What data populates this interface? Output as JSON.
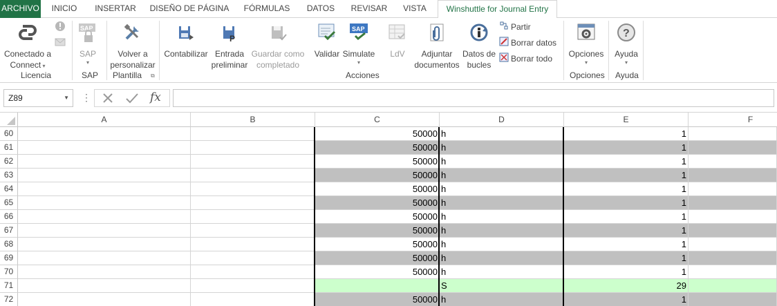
{
  "tabs": [
    "ARCHIVO",
    "INICIO",
    "INSERTAR",
    "DISEÑO DE PÁGINA",
    "FÓRMULAS",
    "DATOS",
    "REVISAR",
    "VISTA",
    "Winshuttle for Journal Entry"
  ],
  "ribbon": {
    "licencia": {
      "connect_line1": "Conectado a",
      "connect_line2": "Connect",
      "group": "Licencia"
    },
    "sap": {
      "sap_label": "SAP",
      "group": "SAP"
    },
    "plantilla": {
      "line1": "Volver a",
      "line2": "personalizar",
      "group": "Plantilla"
    },
    "acciones": {
      "contabilizar": "Contabilizar",
      "entrada_line1": "Entrada",
      "entrada_line2": "preliminar",
      "guardar_line1": "Guardar como",
      "guardar_line2": "completado",
      "validar": "Validar",
      "simulate": "Simulate",
      "ldv": "LdV",
      "adjuntar_line1": "Adjuntar",
      "adjuntar_line2": "documentos",
      "datos_line1": "Datos de",
      "datos_line2": "bucles",
      "partir": "Partir",
      "borrar_datos": "Borrar datos",
      "borrar_todo": "Borrar todo",
      "group": "Acciones"
    },
    "opciones": {
      "label": "Opciones",
      "group": "Opciones"
    },
    "ayuda": {
      "label": "Ayuda",
      "group": "Ayuda"
    }
  },
  "formula_bar": {
    "name_box": "Z89",
    "fx": "fx",
    "formula": ""
  },
  "columns": [
    "A",
    "B",
    "C",
    "D",
    "E",
    "F"
  ],
  "rows": [
    {
      "num": "60",
      "c": "50000",
      "d": "h",
      "e": "1",
      "style": "white"
    },
    {
      "num": "61",
      "c": "50000",
      "d": "h",
      "e": "1",
      "style": "gray"
    },
    {
      "num": "62",
      "c": "50000",
      "d": "h",
      "e": "1",
      "style": "white"
    },
    {
      "num": "63",
      "c": "50000",
      "d": "h",
      "e": "1",
      "style": "gray"
    },
    {
      "num": "64",
      "c": "50000",
      "d": "h",
      "e": "1",
      "style": "white"
    },
    {
      "num": "65",
      "c": "50000",
      "d": "h",
      "e": "1",
      "style": "gray"
    },
    {
      "num": "66",
      "c": "50000",
      "d": "h",
      "e": "1",
      "style": "white"
    },
    {
      "num": "67",
      "c": "50000",
      "d": "h",
      "e": "1",
      "style": "gray"
    },
    {
      "num": "68",
      "c": "50000",
      "d": "h",
      "e": "1",
      "style": "white"
    },
    {
      "num": "69",
      "c": "50000",
      "d": "h",
      "e": "1",
      "style": "gray"
    },
    {
      "num": "70",
      "c": "50000",
      "d": "h",
      "e": "1",
      "style": "white"
    },
    {
      "num": "71",
      "c": "",
      "d": "S",
      "e": "29",
      "style": "green"
    },
    {
      "num": "72",
      "c": "50000",
      "d": "h",
      "e": "1",
      "style": "gray"
    }
  ],
  "colors": {
    "excel_green": "#217346",
    "gray_row": "#c0c0c0",
    "green_row": "#ccffcc"
  }
}
